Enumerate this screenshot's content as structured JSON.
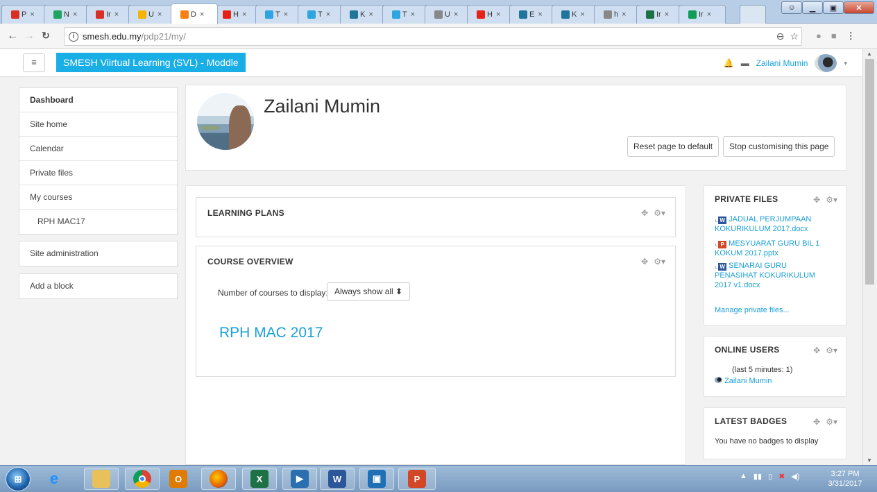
{
  "browser": {
    "tabs": [
      {
        "label": "P",
        "icon": "gmail-icon",
        "color": "#d93025"
      },
      {
        "label": "N",
        "icon": "drive-icon",
        "color": "#1fa463"
      },
      {
        "label": "Ir",
        "icon": "gmail-icon",
        "color": "#d93025"
      },
      {
        "label": "U",
        "icon": "classroom-icon",
        "color": "#f4b400"
      },
      {
        "label": "D",
        "icon": "moodle-icon",
        "color": "#f98012"
      },
      {
        "label": "H",
        "icon": "youtube-icon",
        "color": "#e62117"
      },
      {
        "label": "T",
        "icon": "telegram-icon",
        "color": "#2ca5e0"
      },
      {
        "label": "T",
        "icon": "telegram-icon",
        "color": "#2ca5e0"
      },
      {
        "label": "K",
        "icon": "wordpress-icon",
        "color": "#21759b"
      },
      {
        "label": "T",
        "icon": "telegram-icon",
        "color": "#2ca5e0"
      },
      {
        "label": "U",
        "icon": "page-icon",
        "color": "#888888"
      },
      {
        "label": "H",
        "icon": "youtube-icon",
        "color": "#e62117"
      },
      {
        "label": "E",
        "icon": "wordpress-icon",
        "color": "#21759b"
      },
      {
        "label": "K",
        "icon": "wordpress-icon",
        "color": "#21759b"
      },
      {
        "label": "h",
        "icon": "page-icon",
        "color": "#888888"
      },
      {
        "label": "Ir",
        "icon": "excel-icon",
        "color": "#1e7145"
      },
      {
        "label": "Ir",
        "icon": "sheets-icon",
        "color": "#0f9d58"
      }
    ],
    "close_glyph": "×",
    "url_host": "smesh.edu.my",
    "url_path": "/pdp21/my/"
  },
  "navbar": {
    "menu_glyph": "≡",
    "brand": "SMESH Viirtual Learning (SVL) - Moddle",
    "user_name": "Zailani Mumin"
  },
  "nav": {
    "items": [
      "Dashboard",
      "Site home",
      "Calendar",
      "Private files",
      "My courses",
      "RPH MAC17"
    ],
    "site_admin": "Site administration",
    "add_block": "Add a block"
  },
  "header": {
    "fullname": "Zailani Mumin",
    "reset_label": "Reset page to default",
    "stop_label": "Stop customising this page"
  },
  "learning_plans": {
    "title": "LEARNING PLANS"
  },
  "course_overview": {
    "title": "COURSE OVERVIEW",
    "num_label": "Number of courses to display:",
    "select_value": "Always show all",
    "course": "RPH MAC 2017"
  },
  "private_files": {
    "title": "PRIVATE FILES",
    "files": [
      {
        "line1": "JADUAL PERJUMPAAN",
        "line2": "KOKURIKULUM 2017.docx",
        "type": "W",
        "color": "#2b579a"
      },
      {
        "line1": "MESYUARAT GURU BIL 1",
        "line2": "KOKUM 2017.pptx",
        "type": "P",
        "color": "#d24726"
      },
      {
        "line1": "SENARAI GURU",
        "line2": "PENASIHAT KOKURIKULUM",
        "line3": "2017 v1.docx",
        "type": "W",
        "color": "#2b579a"
      }
    ],
    "manage": "Manage private files..."
  },
  "online_users": {
    "title": "ONLINE USERS",
    "subtitle": "(last 5 minutes: 1)",
    "user": "Zailani Mumin"
  },
  "latest_badges": {
    "title": "LATEST BADGES",
    "text": "You have no badges to display"
  },
  "taskbar": {
    "start": "start-orb",
    "apps": [
      "internet-explorer",
      "file-explorer",
      "chrome",
      "outlook",
      "firefox",
      "excel",
      "projector",
      "word",
      "video",
      "powerpoint"
    ]
  },
  "clock": {
    "time": "3:27 PM",
    "date": "3/31/2017"
  },
  "colors": {
    "accent": "#1aaee6",
    "link": "#1a9fd8"
  }
}
